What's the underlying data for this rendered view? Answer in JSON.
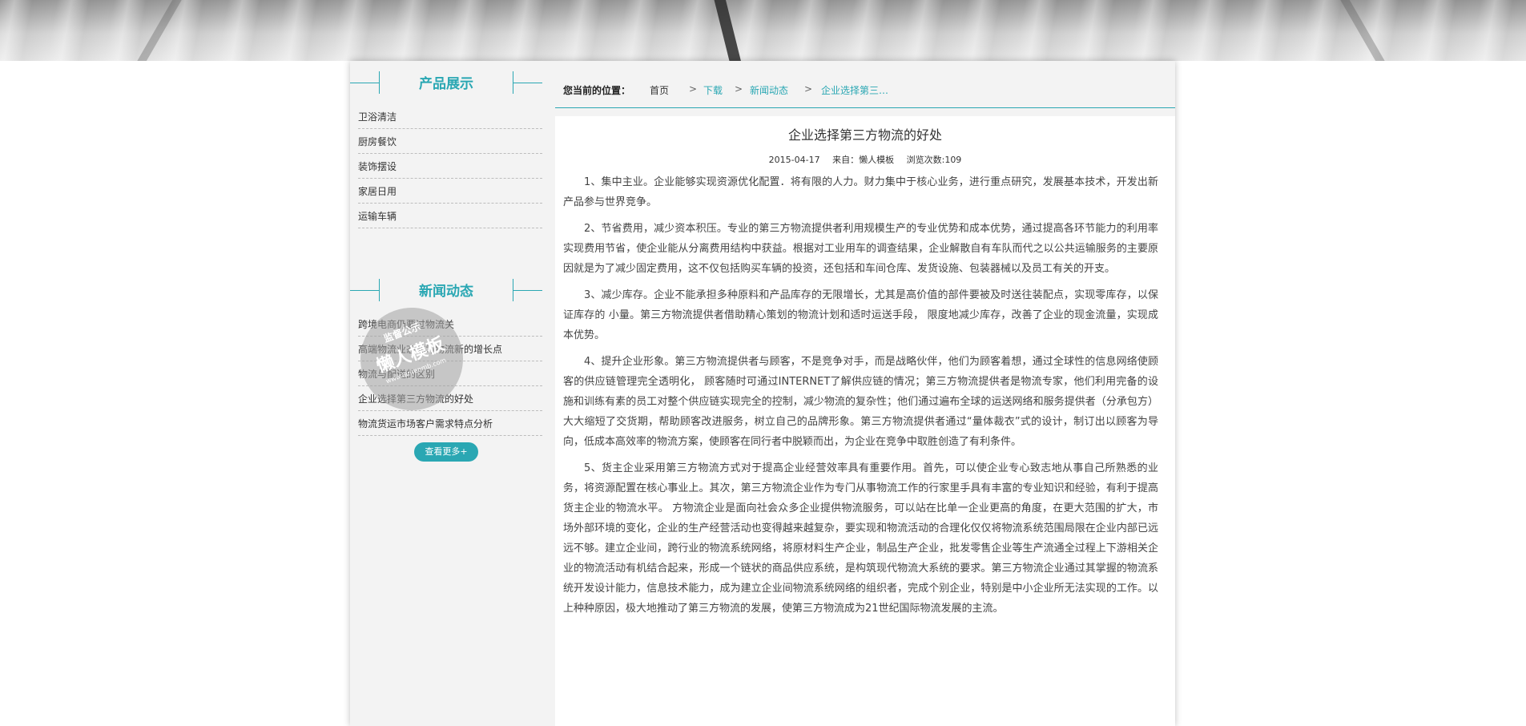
{
  "sidebar": {
    "products_title": "产品展示",
    "products": [
      "卫浴清洁",
      "厨房餐饮",
      "装饰摆设",
      "家居日用",
      "运输车辆"
    ],
    "news_title": "新闻动态",
    "news": [
      "跨境电商仍要过物流关",
      "高端物流业态成为物流新的增长点",
      "物流与配送的区别",
      "企业选择第三方物流的好处",
      "物流货运市场客户需求特点分析"
    ],
    "more_button": "查看更多+"
  },
  "breadcrumb": {
    "label": "您当前的位置：",
    "items": [
      "首页",
      "下载",
      "新闻动态",
      "企业选择第三…"
    ],
    "separator": ">"
  },
  "article": {
    "title": "企业选择第三方物流的好处",
    "date": "2015-04-17",
    "source": "来自：懒人模板",
    "views": "浏览次数:109",
    "paragraphs": [
      "1、集中主业。企业能够实现资源优化配置．将有限的人力。财力集中于核心业务，进行重点研究，发展基本技术，开发出新产品参与世界竞争。",
      "2、节省费用，减少资本积压。专业的第三方物流提供者利用规模生产的专业优势和成本优势，通过提高各环节能力的利用率实现费用节省，使企业能从分离费用结构中获益。根据对工业用车的调查结果，企业解散自有车队而代之以公共运输服务的主要原因就是为了减少固定费用，这不仅包括购买车辆的投资，还包括和车间仓库、发货设施、包装器械以及员工有关的开支。",
      "3、减少库存。企业不能承担多种原料和产品库存的无限增长，尤其是高价值的部件要被及时送往装配点，实现零库存，以保证库存的 小量。第三方物流提供者借助精心策划的物流计划和适时运送手段， 限度地减少库存，改善了企业的现金流量，实现成本优势。",
      "4、提升企业形象。第三方物流提供者与顾客，不是竞争对手，而是战略伙伴，他们为顾客着想，通过全球性的信息网络使顾客的供应链管理完全透明化， 顾客随时可通过INTERNET了解供应链的情况；第三方物流提供者是物流专家，他们利用完备的设施和训练有素的员工对整个供应链实现完全的控制，减少物流的复杂性；他们通过遍布全球的运送网络和服务提供者（分承包方）大大缩短了交货期，帮助顾客改进服务，树立自己的品牌形象。第三方物流提供者通过“量体裁衣”式的设计，制订出以顾客为导向，低成本高效率的物流方案，使顾客在同行者中脱颖而出，为企业在竞争中取胜创造了有利条件。",
      "5、货主企业采用第三方物流方式对于提高企业经营效率具有重要作用。首先，可以使企业专心致志地从事自己所熟悉的业务，将资源配置在核心事业上。其次，第三方物流企业作为专门从事物流工作的行家里手具有丰富的专业知识和经验，有利于提高货主企业的物流水平。 方物流企业是面向社会众多企业提供物流服务，可以站在比单一企业更高的角度，在更大范围的扩大，市场外部环境的变化，企业的生产经营活动也变得越来越复杂，要实现和物流活动的合理化仅仅将物流系统范围局限在企业内部已远远不够。建立企业间，跨行业的物流系统网络，将原材料生产企业，制品生产企业，批发零售企业等生产流通全过程上下游相关企业的物流活动有机结合起来，形成一个链状的商品供应系统，是构筑现代物流大系统的要求。第三方物流企业通过其掌握的物流系统开发设计能力，信息技术能力，成为建立企业间物流系统网络的组织者，完成个别企业，特别是中小企业所无法实现的工作。以上种种原因，极大地推动了第三方物流的发展，使第三方物流成为21世纪国际物流发展的主流。"
    ]
  },
  "watermark": {
    "line1": "监督公示",
    "line2": "懒人模板",
    "line3": "www.lanrenmb.com"
  },
  "colors": {
    "accent": "#2aa7b3"
  }
}
